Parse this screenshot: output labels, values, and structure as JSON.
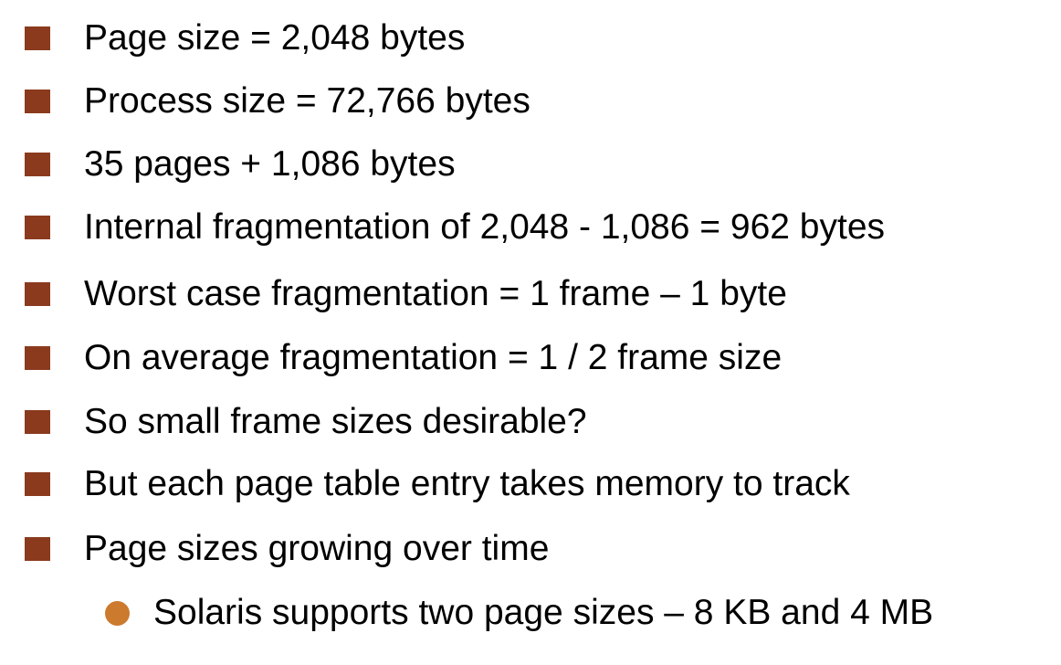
{
  "bullets": [
    {
      "text": "Page size = 2,048 bytes"
    },
    {
      "text": "Process size = 72,766 bytes"
    },
    {
      "text": "35 pages + 1,086 bytes"
    },
    {
      "text": "Internal fragmentation of 2,048 - 1,086 = 962 bytes"
    },
    {
      "text": "Worst case fragmentation = 1 frame – 1 byte"
    },
    {
      "text": "On average fragmentation = 1 / 2 frame size"
    },
    {
      "text": "So small frame sizes desirable?"
    },
    {
      "text": "But each page table entry takes memory to track"
    },
    {
      "text": "Page sizes growing over time"
    }
  ],
  "sub_bullets": [
    {
      "text": "Solaris supports two page sizes – 8 KB and 4 MB"
    }
  ],
  "colors": {
    "bullet_square": "#8b3a1e",
    "bullet_circle": "#cc7a2e",
    "text": "#000000",
    "background": "#ffffff"
  }
}
